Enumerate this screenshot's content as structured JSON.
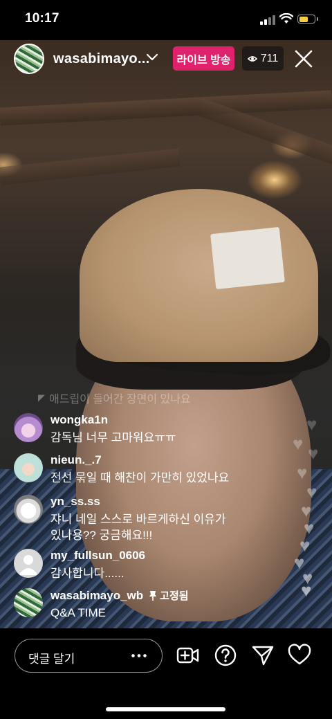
{
  "status_bar": {
    "time": "10:17"
  },
  "header": {
    "host_username": "wasabimayo...",
    "live_badge": "라이브 방송",
    "viewer_count": "711"
  },
  "faded_comment": "애드립이 들어간 장면이 있나요",
  "comments": [
    {
      "username": "wongka1n",
      "text": "감독님 너무 고마워요ㅠㅠ"
    },
    {
      "username": "nieun._.7",
      "text": "전선 묶일 때 해찬이 가만히 있었나요"
    },
    {
      "username": "yn_ss.ss",
      "text_line1": "쟈니 네일 스스로 바르게하신 이유가",
      "text_line2": "있나용?? 궁금해요!!!"
    },
    {
      "username": "my_fullsun_0606",
      "text": "감사합니다......"
    },
    {
      "username": "wasabimayo_wb",
      "pinned_label": "고정됨",
      "text": "Q&A TIME"
    }
  ],
  "bottom_bar": {
    "comment_placeholder": "댓글 달기"
  },
  "colors": {
    "live_badge": "#e0216b",
    "battery": "#f7ce46"
  }
}
